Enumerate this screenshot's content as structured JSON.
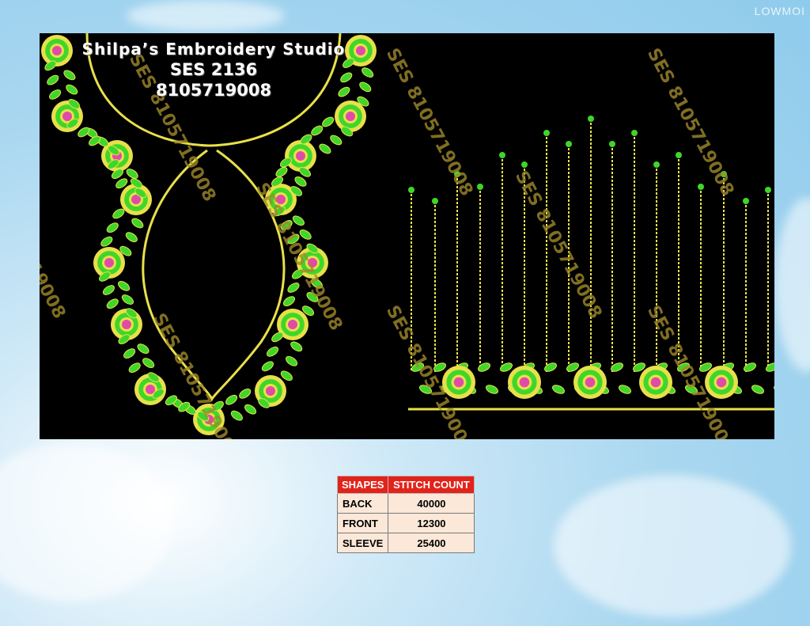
{
  "studio": {
    "name": "Shilpa’s Embroidery Studio",
    "code": "SES 2136",
    "phone": "8105719008"
  },
  "watermark": "SES 8105719008",
  "corner_mark": "LOWMOI",
  "table": {
    "headers": [
      "SHAPES",
      "STITCH COUNT"
    ],
    "rows": [
      {
        "shape": "BACK",
        "count": "40000"
      },
      {
        "shape": "FRONT",
        "count": "12300"
      },
      {
        "shape": "SLEEVE",
        "count": "25400"
      }
    ]
  },
  "colors": {
    "background": "#000000",
    "gold": "#e8e04a",
    "leaf": "#3fd62a",
    "flower_center": "#e04ba8",
    "header_red": "#e2231a",
    "cell": "#fbe8d8"
  }
}
